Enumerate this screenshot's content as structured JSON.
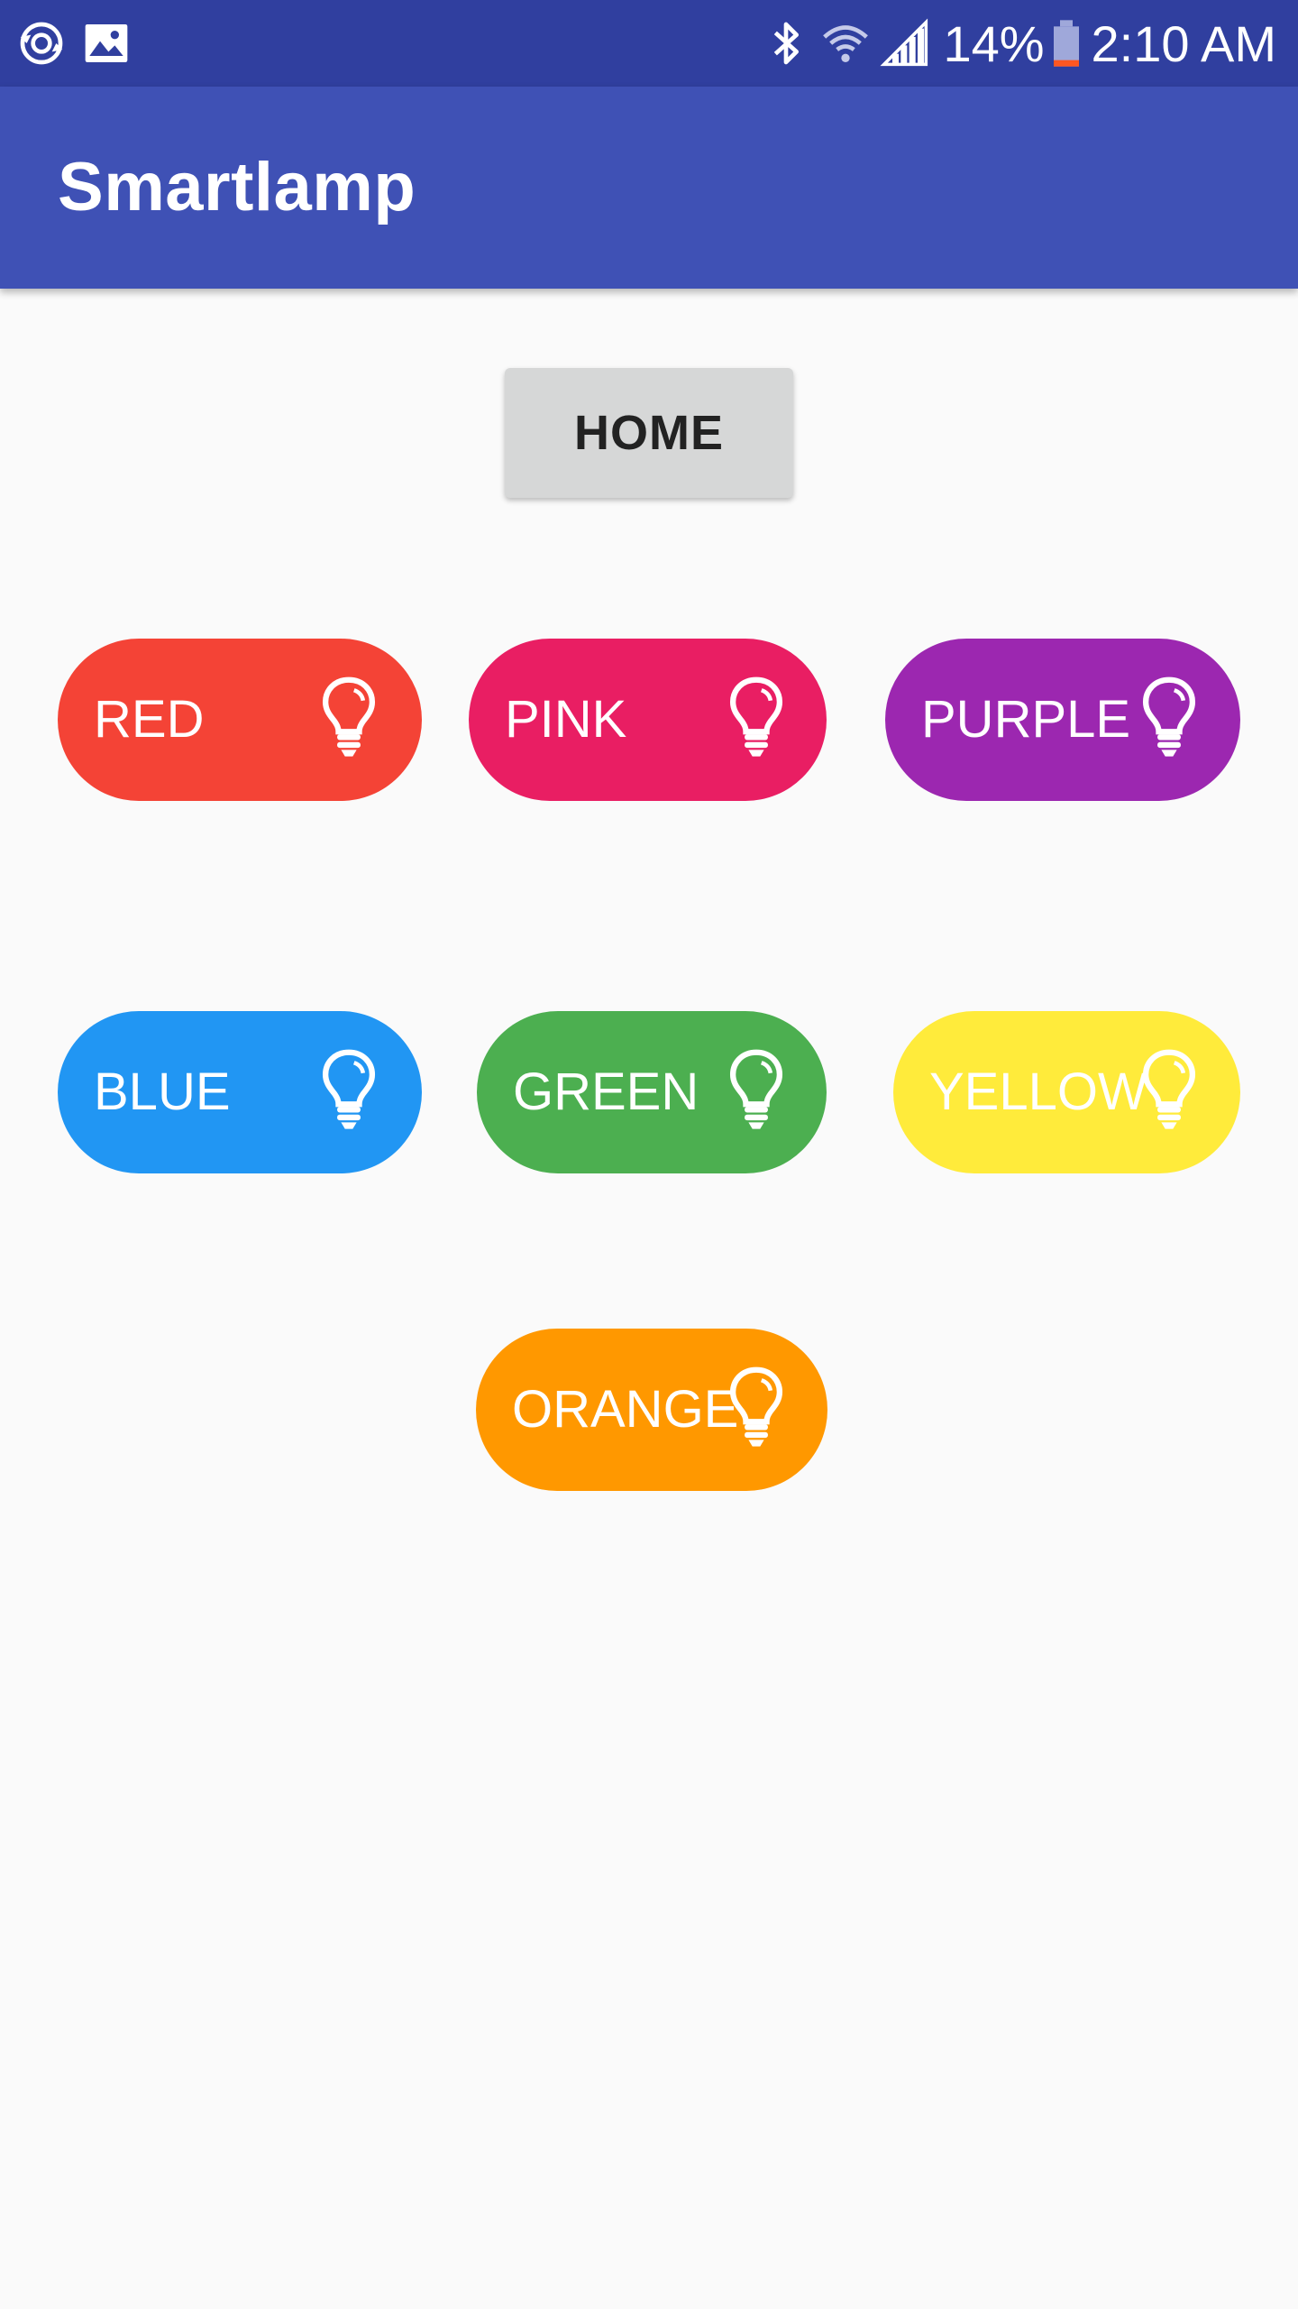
{
  "status_bar": {
    "left_icons": [
      "sync-icon",
      "image-icon"
    ],
    "right_icons": [
      "bluetooth-icon",
      "wifi-icon",
      "signal-icon",
      "battery-icon"
    ],
    "battery_percent": "14%",
    "time": "2:10 AM",
    "background_color": "#303f9f"
  },
  "app_bar": {
    "title": "Smartlamp",
    "background_color": "#3f51b5"
  },
  "home_button": {
    "label": "HOME"
  },
  "color_buttons": [
    {
      "label": "RED",
      "color": "#f44336",
      "icon": "lightbulb-icon"
    },
    {
      "label": "PINK",
      "color": "#e91e63",
      "icon": "lightbulb-icon"
    },
    {
      "label": "PURPLE",
      "color": "#9c27b0",
      "icon": "lightbulb-icon"
    },
    {
      "label": "BLUE",
      "color": "#2196f3",
      "icon": "lightbulb-icon"
    },
    {
      "label": "GREEN",
      "color": "#4caf50",
      "icon": "lightbulb-icon"
    },
    {
      "label": "YELLOW",
      "color": "#ffeb3b",
      "icon": "lightbulb-icon"
    },
    {
      "label": "ORANGE",
      "color": "#ff9800",
      "icon": "lightbulb-icon"
    }
  ]
}
